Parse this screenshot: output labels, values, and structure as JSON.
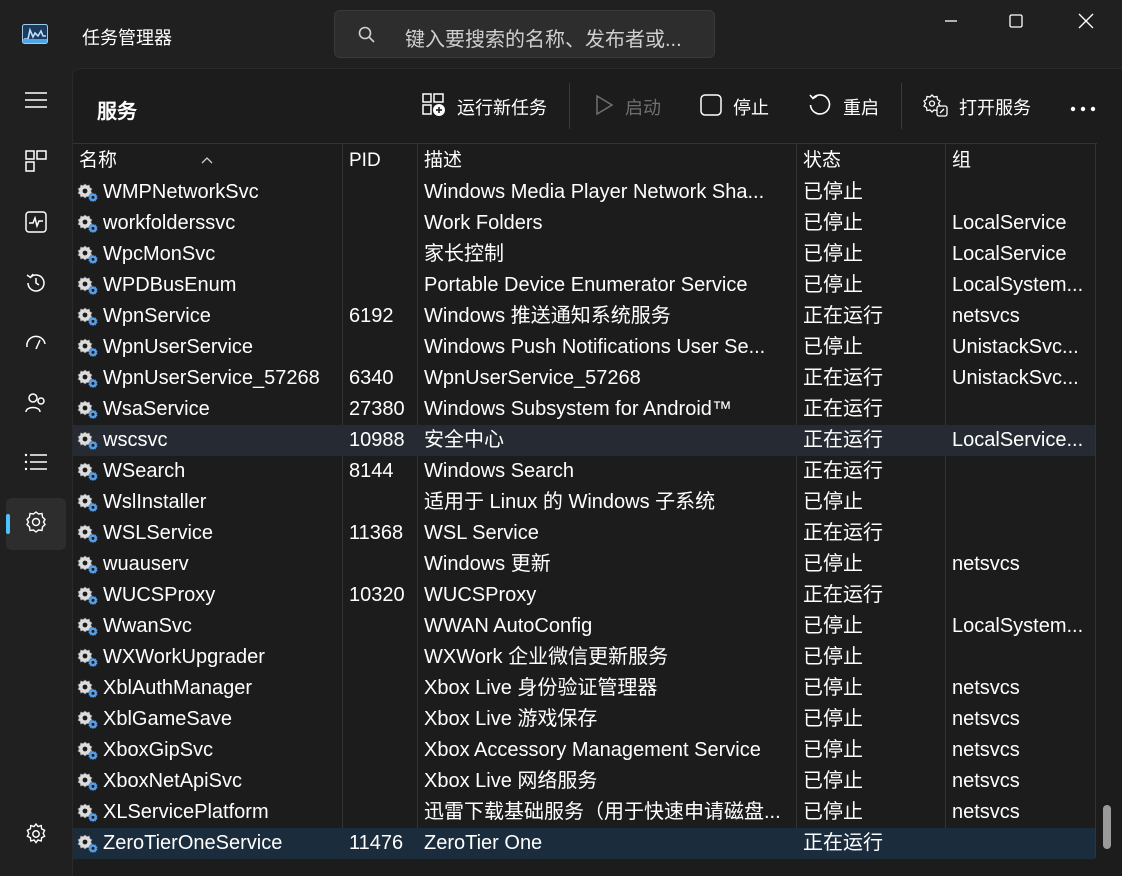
{
  "app": {
    "title": "任务管理器",
    "search_placeholder": "键入要搜索的名称、发布者或..."
  },
  "window_controls": [
    "minimize-icon",
    "maximize-icon",
    "close-icon"
  ],
  "nav": {
    "items": [
      {
        "name": "hamburger-menu-icon"
      },
      {
        "name": "processes-icon"
      },
      {
        "name": "performance-icon"
      },
      {
        "name": "app-history-icon"
      },
      {
        "name": "startup-apps-icon"
      },
      {
        "name": "users-icon"
      },
      {
        "name": "details-icon"
      },
      {
        "name": "services-icon",
        "active": true
      },
      {
        "name": "settings-icon"
      }
    ]
  },
  "page": {
    "title": "服务",
    "commands": {
      "run_new_task": "运行新任务",
      "start": "启动",
      "stop": "停止",
      "restart": "重启",
      "open_services": "打开服务"
    }
  },
  "table": {
    "columns": {
      "name": "名称",
      "pid": "PID",
      "desc": "描述",
      "status": "状态",
      "group": "组"
    },
    "rows": [
      {
        "name": "WMPNetworkSvc",
        "pid": "",
        "desc": "Windows Media Player Network Sha...",
        "status": "已停止",
        "group": ""
      },
      {
        "name": "workfolderssvc",
        "pid": "",
        "desc": "Work Folders",
        "status": "已停止",
        "group": "LocalService"
      },
      {
        "name": "WpcMonSvc",
        "pid": "",
        "desc": "家长控制",
        "status": "已停止",
        "group": "LocalService"
      },
      {
        "name": "WPDBusEnum",
        "pid": "",
        "desc": "Portable Device Enumerator Service",
        "status": "已停止",
        "group": "LocalSystem..."
      },
      {
        "name": "WpnService",
        "pid": "6192",
        "desc": "Windows 推送通知系统服务",
        "status": "正在运行",
        "group": "netsvcs"
      },
      {
        "name": "WpnUserService",
        "pid": "",
        "desc": "Windows Push Notifications User Se...",
        "status": "已停止",
        "group": "UnistackSvc..."
      },
      {
        "name": "WpnUserService_57268",
        "pid": "6340",
        "desc": "WpnUserService_57268",
        "status": "正在运行",
        "group": "UnistackSvc..."
      },
      {
        "name": "WsaService",
        "pid": "27380",
        "desc": "Windows Subsystem for Android™",
        "status": "正在运行",
        "group": ""
      },
      {
        "name": "wscsvc",
        "pid": "10988",
        "desc": "安全中心",
        "status": "正在运行",
        "group": "LocalService..."
      },
      {
        "name": "WSearch",
        "pid": "8144",
        "desc": "Windows Search",
        "status": "正在运行",
        "group": ""
      },
      {
        "name": "WslInstaller",
        "pid": "",
        "desc": "适用于 Linux 的 Windows 子系统",
        "status": "已停止",
        "group": ""
      },
      {
        "name": "WSLService",
        "pid": "11368",
        "desc": "WSL Service",
        "status": "正在运行",
        "group": ""
      },
      {
        "name": "wuauserv",
        "pid": "",
        "desc": "Windows 更新",
        "status": "已停止",
        "group": "netsvcs"
      },
      {
        "name": "WUCSProxy",
        "pid": "10320",
        "desc": "WUCSProxy",
        "status": "正在运行",
        "group": ""
      },
      {
        "name": "WwanSvc",
        "pid": "",
        "desc": "WWAN AutoConfig",
        "status": "已停止",
        "group": "LocalSystem..."
      },
      {
        "name": "WXWorkUpgrader",
        "pid": "",
        "desc": "WXWork 企业微信更新服务",
        "status": "已停止",
        "group": ""
      },
      {
        "name": "XblAuthManager",
        "pid": "",
        "desc": "Xbox Live 身份验证管理器",
        "status": "已停止",
        "group": "netsvcs"
      },
      {
        "name": "XblGameSave",
        "pid": "",
        "desc": "Xbox Live 游戏保存",
        "status": "已停止",
        "group": "netsvcs"
      },
      {
        "name": "XboxGipSvc",
        "pid": "",
        "desc": "Xbox Accessory Management Service",
        "status": "已停止",
        "group": "netsvcs"
      },
      {
        "name": "XboxNetApiSvc",
        "pid": "",
        "desc": "Xbox Live 网络服务",
        "status": "已停止",
        "group": "netsvcs"
      },
      {
        "name": "XLServicePlatform",
        "pid": "",
        "desc": "迅雷下载基础服务（用于快速申请磁盘...",
        "status": "已停止",
        "group": "netsvcs"
      },
      {
        "name": "ZeroTierOneService",
        "pid": "11476",
        "desc": "ZeroTier One",
        "status": "正在运行",
        "group": ""
      }
    ],
    "hover_row": 8,
    "selected_row": 21
  }
}
